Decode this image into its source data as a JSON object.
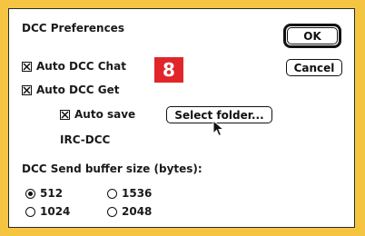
{
  "dialog": {
    "title": "DCC Preferences",
    "ok_label": "OK",
    "cancel_label": "Cancel",
    "auto_dcc_chat": {
      "label": "Auto DCC Chat",
      "checked": true
    },
    "auto_dcc_get": {
      "label": "Auto DCC Get",
      "checked": true
    },
    "auto_save": {
      "label": "Auto save",
      "checked": true
    },
    "select_folder_label": "Select folder...",
    "folder_name": "IRC-DCC",
    "buffer_label": "DCC Send buffer size (bytes):",
    "buffer_options": [
      {
        "label": "512",
        "selected": true
      },
      {
        "label": "1536",
        "selected": false
      },
      {
        "label": "1024",
        "selected": false
      },
      {
        "label": "2048",
        "selected": false
      }
    ]
  },
  "badge": {
    "text": "8",
    "color": "#e0262a"
  },
  "colors": {
    "background": "#f5c542",
    "dialog": "#ffffff"
  }
}
